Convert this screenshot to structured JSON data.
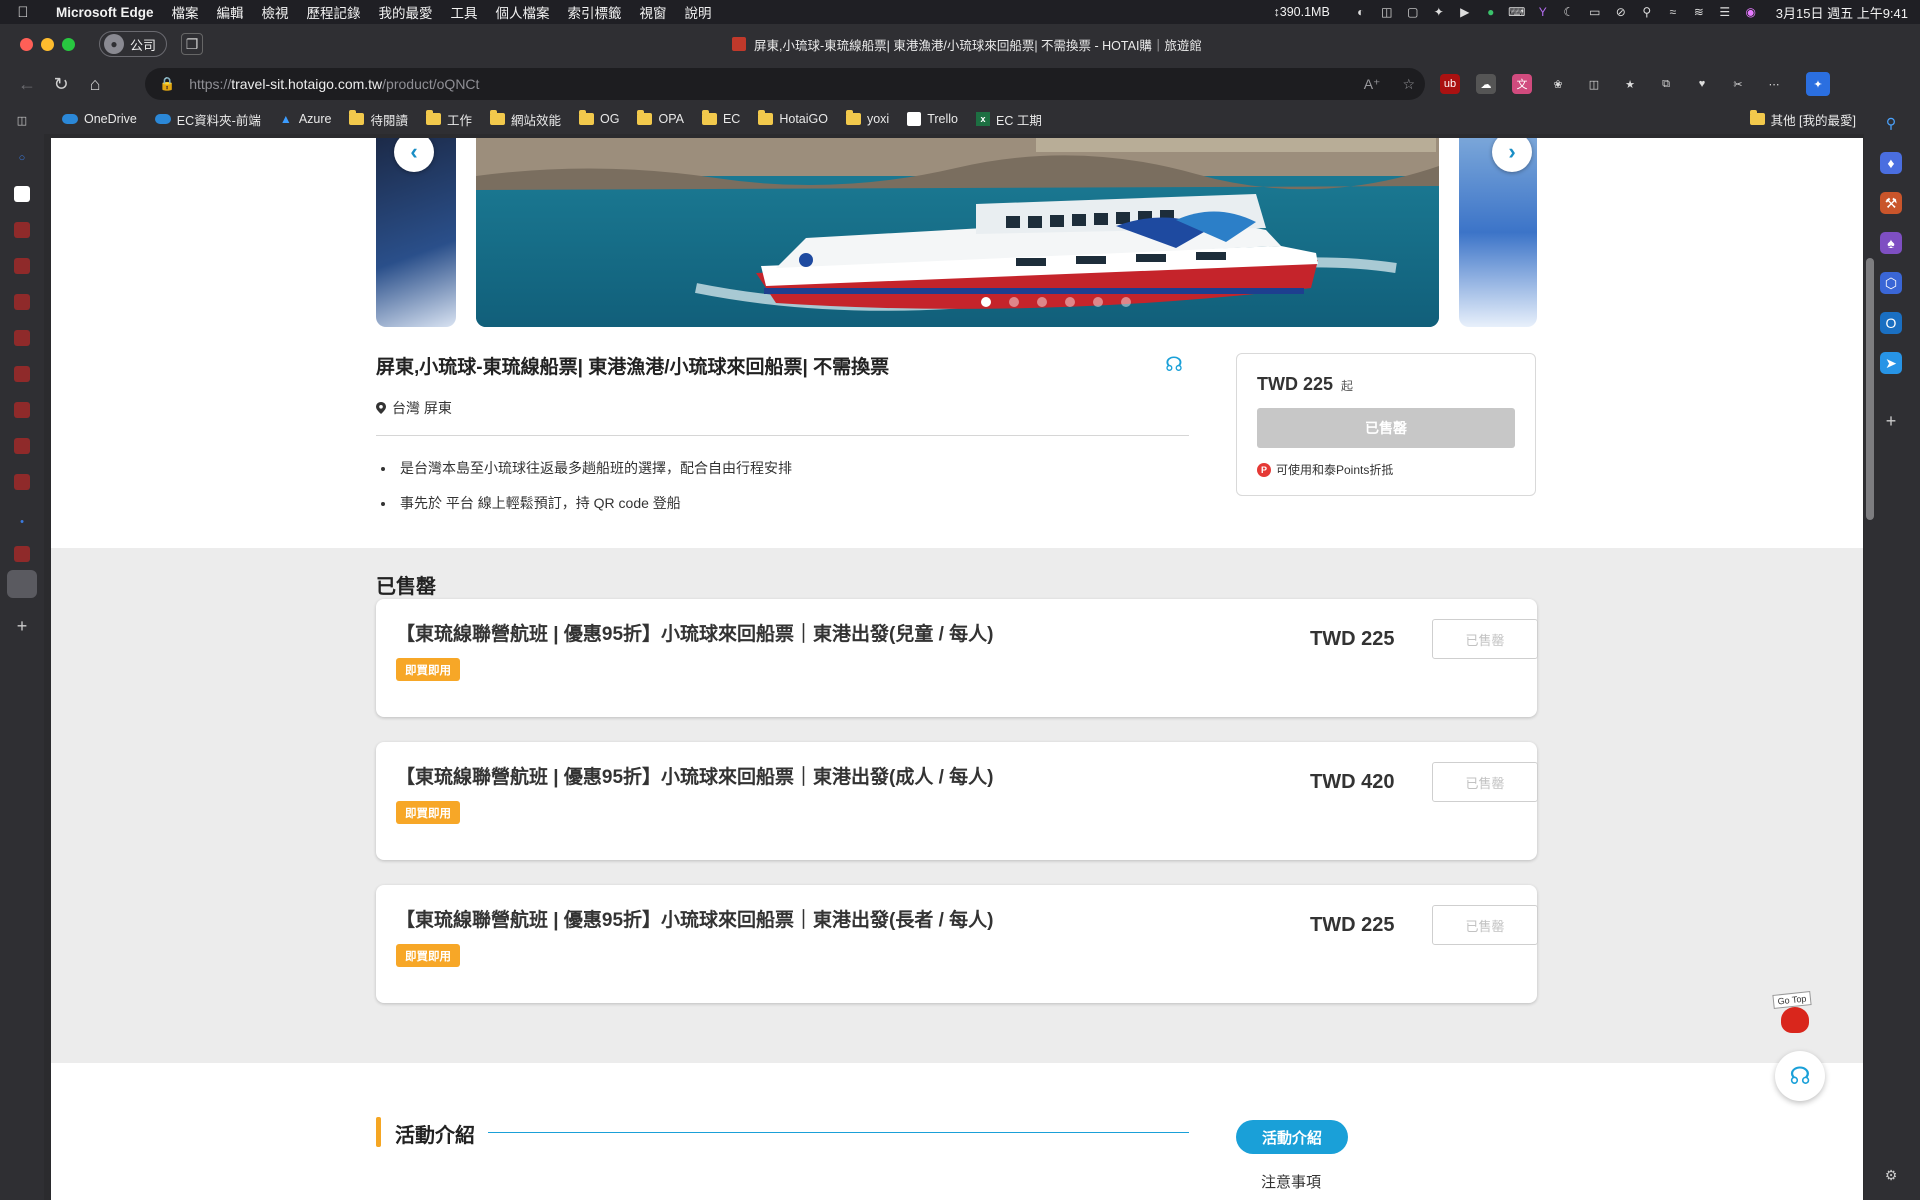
{
  "menubar": {
    "app_name": "Microsoft Edge",
    "items": [
      "檔案",
      "編輯",
      "檢視",
      "歷程記錄",
      "我的最愛",
      "工具",
      "個人檔案",
      "索引標籤",
      "視窗",
      "說明"
    ],
    "memory_stat": "↕390.1MB",
    "clock": "3月15日 週五 上午9:41"
  },
  "browser": {
    "profile_label": "公司",
    "tab_title": "屏東,小琉球-東琉線船票| 東港漁港/小琉球來回船票| 不需換票 - HOTAI購｜旅遊館",
    "url_prefix": "https://",
    "url_host": "travel-sit.hotaigo.com.tw",
    "url_path": "/product/oQNCt",
    "bookmarks": [
      {
        "label": "OneDrive",
        "icon": "onedrive-cloud"
      },
      {
        "label": "EC資料夾-前端",
        "icon": "onedrive-cloud"
      },
      {
        "label": "Azure",
        "icon": "azure"
      },
      {
        "label": "待閱讀",
        "icon": "folder"
      },
      {
        "label": "工作",
        "icon": "folder"
      },
      {
        "label": "網站效能",
        "icon": "folder"
      },
      {
        "label": "OG",
        "icon": "folder"
      },
      {
        "label": "OPA",
        "icon": "folder"
      },
      {
        "label": "EC",
        "icon": "folder"
      },
      {
        "label": "HotaiGO",
        "icon": "folder"
      },
      {
        "label": "yoxi",
        "icon": "folder"
      },
      {
        "label": "Trello",
        "icon": "trello"
      },
      {
        "label": "EC 工期",
        "icon": "excel"
      }
    ],
    "other_bookmarks": "其他 [我的最愛]"
  },
  "product": {
    "title": "屏東,小琉球-東琉線船票| 東港漁港/小琉球來回船票| 不需換票",
    "location": "台灣 屏東",
    "highlights": [
      "是台灣本島至小琉球往返最多趟船班的選擇，配合自由行程安排",
      "事先於 平台 線上輕鬆預訂，持 QR code 登船"
    ],
    "carousel_dot_count": 6,
    "carousel_active_dot": 0,
    "price": "TWD 225",
    "price_suffix": "起",
    "soldout_label": "已售罄",
    "points_label": "可使用和泰Points折抵"
  },
  "packages": {
    "section_title": "已售罄",
    "items": [
      {
        "name": "【東琉線聯營航班 | 優惠95折】小琉球來回船票｜東港出發(兒童 / 每人)",
        "tag": "即買即用",
        "price": "TWD 225",
        "button": "已售罄"
      },
      {
        "name": "【東琉線聯營航班 | 優惠95折】小琉球來回船票｜東港出發(成人 / 每人)",
        "tag": "即買即用",
        "price": "TWD 420",
        "button": "已售罄"
      },
      {
        "name": "【東琉線聯營航班 | 優惠95折】小琉球來回船票｜東港出發(長者 / 每人)",
        "tag": "即買即用",
        "price": "TWD 225",
        "button": "已售罄"
      }
    ]
  },
  "activity": {
    "title": "活動介紹",
    "nav_active": "活動介紹",
    "nav_next": "注意事項"
  },
  "widgets": {
    "gotop_label": "Go Top"
  },
  "colors": {
    "brand_blue": "#1aa0d8",
    "tag_orange": "#f7a727",
    "soldout_gray": "#c7c7c7"
  }
}
